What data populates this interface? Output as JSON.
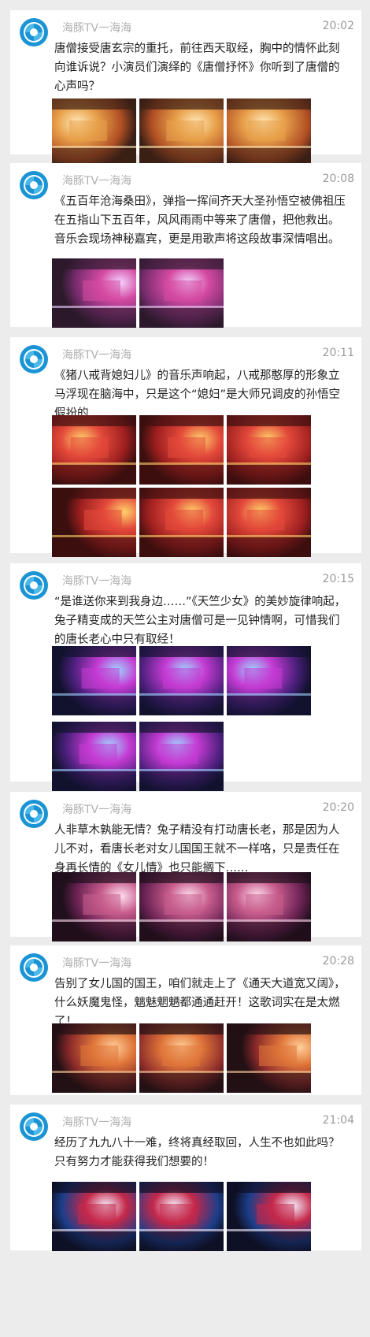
{
  "feed": {
    "posts": [
      {
        "author": "海豚TV一海海",
        "time": "20:02",
        "text": "唐僧接受唐玄宗的重托，前往西天取经，胸中的情怀此刻向谁诉说？小演员们演绎的《唐僧抒怀》你听到了唐僧的心声吗？",
        "photos": [
          "stage-photo",
          "stage-photo",
          "stage-photo"
        ]
      },
      {
        "author": "海豚TV一海海",
        "time": "20:08",
        "text": "《五百年沧海桑田》，弹指一挥间齐天大圣孙悟空被佛祖压在五指山下五百年，风风雨雨中等来了唐僧，把他救出。音乐会现场神秘嘉宾，更是用歌声将这段故事深情唱出。",
        "photos": [
          "stage-photo",
          "stage-photo"
        ]
      },
      {
        "author": "海豚TV一海海",
        "time": "20:11",
        "text": "《猪八戒背媳妇儿》的音乐声响起，八戒那憨厚的形象立马浮现在脑海中，只是这个“媳妇”是大师兄调皮的孙悟空假扮的……",
        "photos": [
          "stage-photo",
          "stage-photo",
          "stage-photo",
          "stage-photo",
          "stage-photo",
          "stage-photo"
        ]
      },
      {
        "author": "海豚TV一海海",
        "time": "20:15",
        "text": "“是谁送你来到我身边……”《天竺少女》的美妙旋律响起，兔子精变成的天竺公主对唐僧可是一见钟情啊，可惜我们的唐长老心中只有取经！",
        "photos": [
          "stage-photo",
          "stage-photo",
          "stage-photo",
          "stage-photo",
          "stage-photo"
        ]
      },
      {
        "author": "海豚TV一海海",
        "time": "20:20",
        "text": "人非草木孰能无情？兔子精没有打动唐长老，那是因为人儿不对，看唐长老对女儿国国王就不一样咯，只是责任在身再长情的《女儿情》也只能搁下……",
        "photos": [
          "stage-photo",
          "stage-photo",
          "stage-photo"
        ]
      },
      {
        "author": "海豚TV一海海",
        "time": "20:28",
        "text": "告别了女儿国的国王，咱们就走上了《通天大道宽又阔》，什么妖魔鬼怪，魑魅魍魉都通通赶开！这歌词实在是太燃了！",
        "photos": [
          "stage-photo",
          "stage-photo",
          "stage-photo"
        ]
      },
      {
        "author": "海豚TV一海海",
        "time": "21:04",
        "text": "经历了九九八十一难，终将真经取回，人生不也如此吗？只有努力才能获得我们想要的！",
        "photos": [
          "stage-photo",
          "stage-photo",
          "stage-photo"
        ]
      }
    ]
  }
}
